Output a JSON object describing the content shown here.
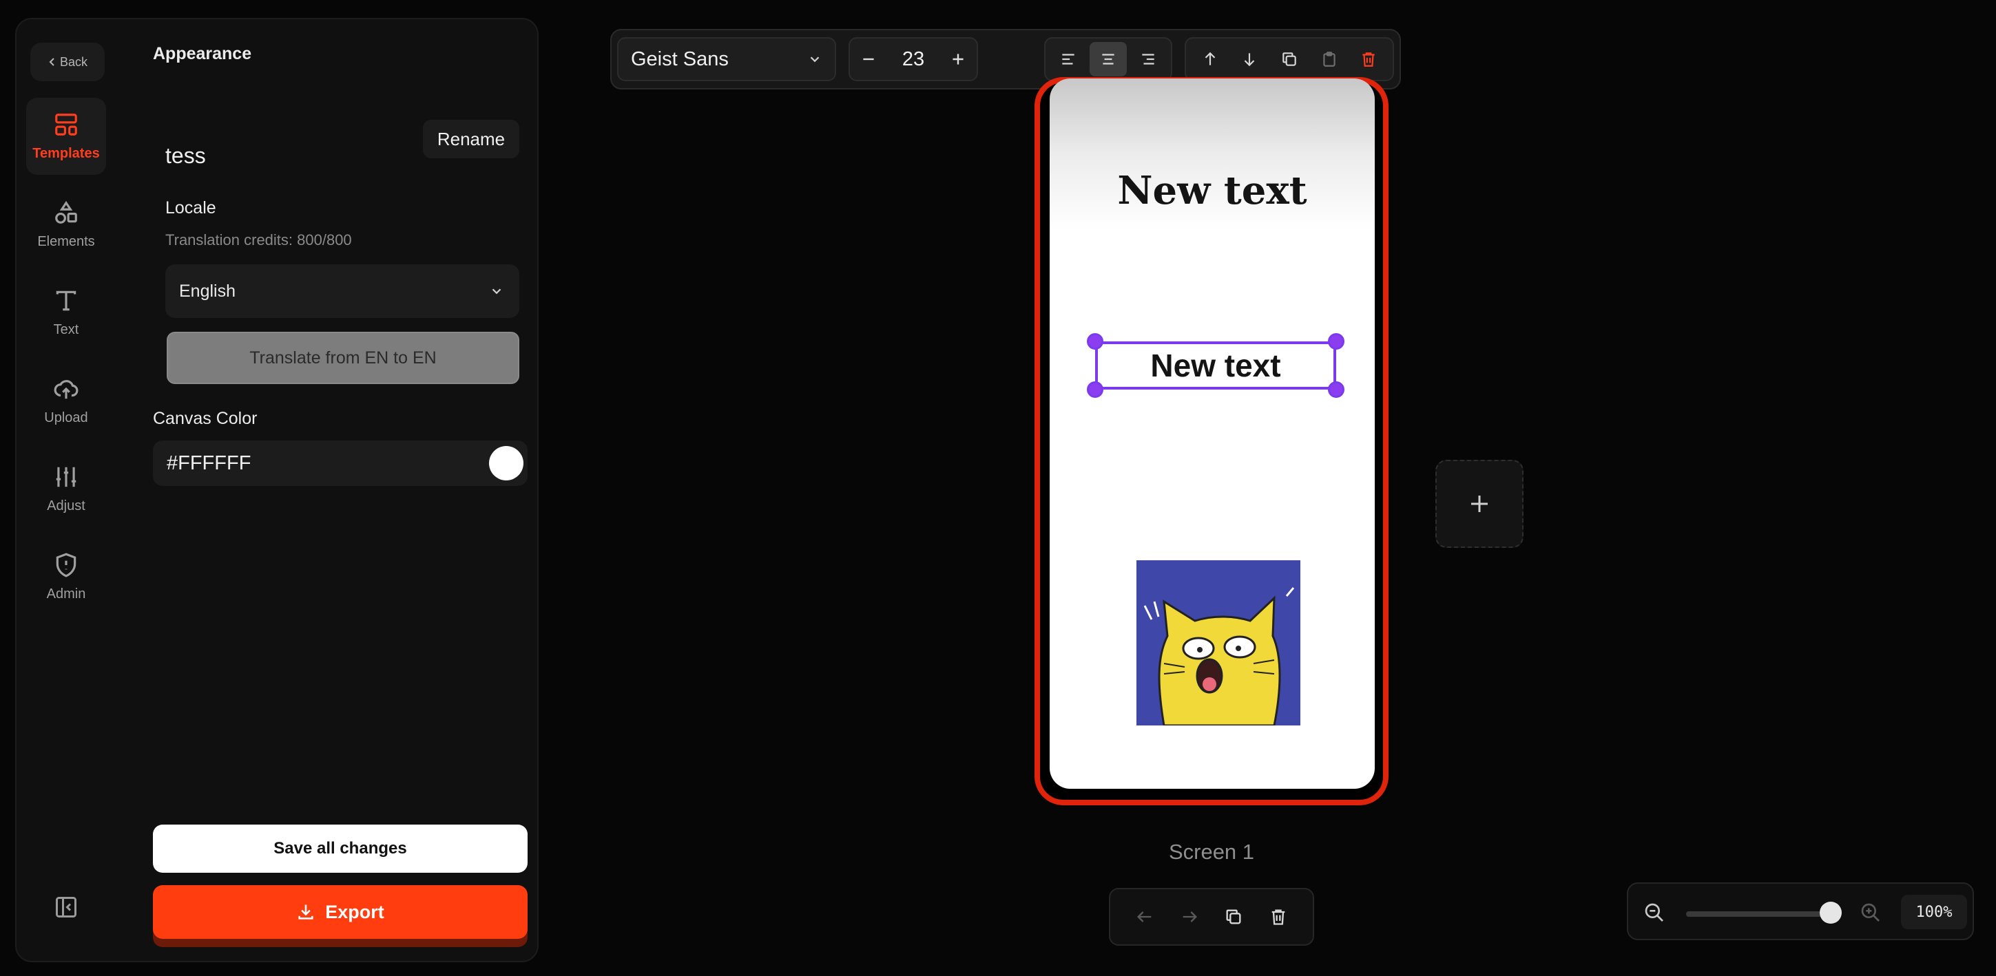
{
  "sidebar": {
    "back_label": "Back",
    "nav": [
      {
        "label": "Templates"
      },
      {
        "label": "Elements"
      },
      {
        "label": "Text"
      },
      {
        "label": "Upload"
      },
      {
        "label": "Adjust"
      },
      {
        "label": "Admin"
      }
    ],
    "active_nav": "Templates",
    "accent_color": "#ff3d1f"
  },
  "panel": {
    "title": "Appearance",
    "project_name": "tess",
    "rename_label": "Rename",
    "locale_label": "Locale",
    "credits_text": "Translation credits: 800/800",
    "language": "English",
    "translate_label": "Translate from EN to EN",
    "canvas_color_label": "Canvas Color",
    "canvas_color_value": "#FFFFFF",
    "save_label": "Save all changes",
    "export_label": "Export"
  },
  "toolbar": {
    "font_family": "Geist Sans",
    "font_size": "23",
    "alignment": "center"
  },
  "canvas": {
    "heading_text": "New text",
    "selected_text": "New text",
    "image_icon": "surprised-cat-image",
    "frame_color": "#e0230b",
    "selection_color": "#7c3aed",
    "screen_label": "Screen 1"
  },
  "zoom": {
    "value_text": "100%",
    "level": 1.0
  }
}
